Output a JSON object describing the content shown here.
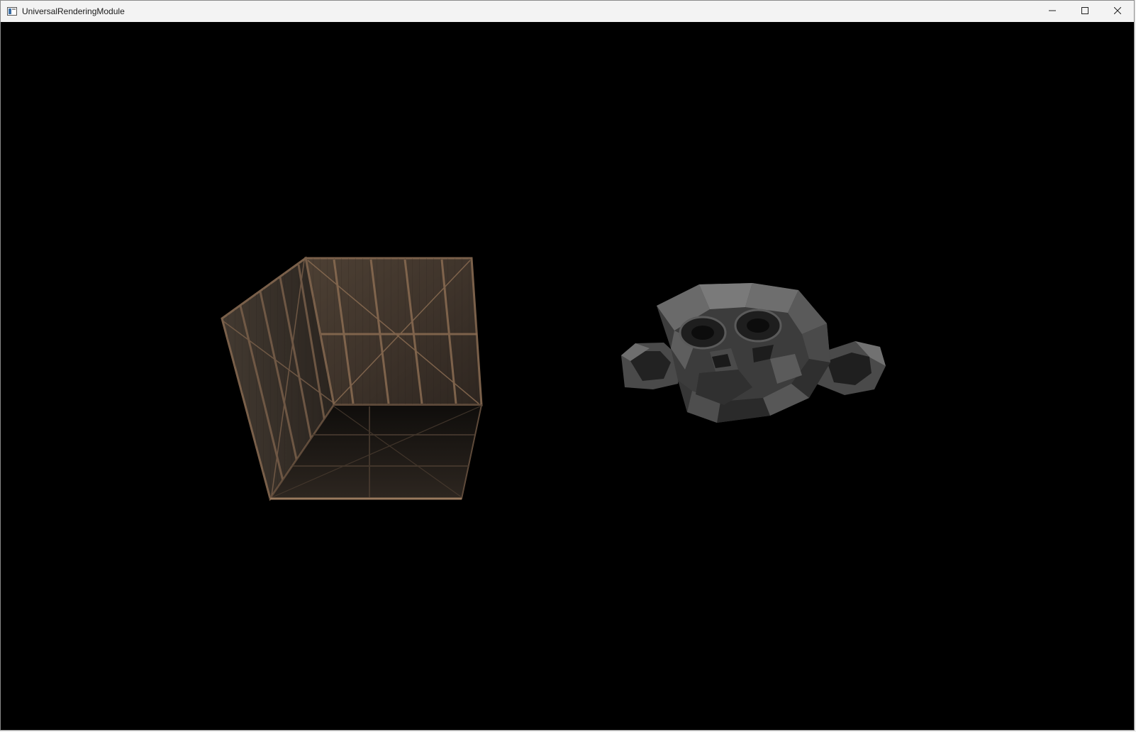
{
  "window": {
    "title": "UniversalRenderingModule",
    "icon": "app-window-icon",
    "controls": {
      "minimize_icon": "minimize-icon",
      "maximize_icon": "maximize-icon",
      "close_icon": "close-icon"
    }
  },
  "scene": {
    "background_color": "#000000",
    "objects": [
      {
        "name": "wooden-crate",
        "material": "wood-texture",
        "color": "#5a4a3c"
      },
      {
        "name": "monkey-head",
        "material": "flat-shaded-gray",
        "color": "#5a5a5a"
      }
    ]
  }
}
